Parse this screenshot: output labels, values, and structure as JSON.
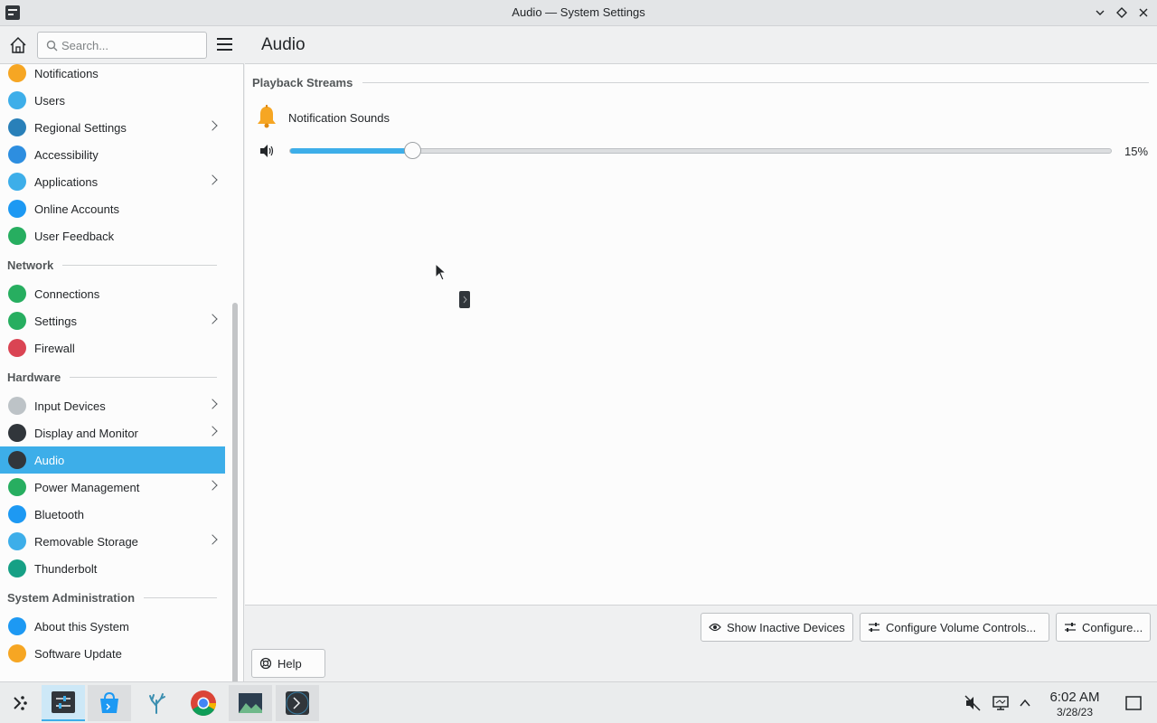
{
  "window": {
    "title": "Audio — System Settings"
  },
  "sidebar": {
    "search_placeholder": "Search...",
    "items_top": [
      {
        "label": "Notifications",
        "icon": "bell-icon",
        "color": "#f6a623",
        "chevron": false
      },
      {
        "label": "Users",
        "icon": "users-icon",
        "color": "#3daee9",
        "chevron": false
      },
      {
        "label": "Regional Settings",
        "icon": "regional-icon",
        "color": "#2980b9",
        "chevron": true
      },
      {
        "label": "Accessibility",
        "icon": "accessibility-icon",
        "color": "#2d8ee0",
        "chevron": false
      },
      {
        "label": "Applications",
        "icon": "applications-icon",
        "color": "#3daee9",
        "chevron": true
      },
      {
        "label": "Online Accounts",
        "icon": "online-accounts-icon",
        "color": "#1d99f3",
        "chevron": false
      },
      {
        "label": "User Feedback",
        "icon": "feedback-icon",
        "color": "#27ae60",
        "chevron": false
      }
    ],
    "network_header": "Network",
    "network_items": [
      {
        "label": "Connections",
        "icon": "globe-icon",
        "color": "#27ae60",
        "chevron": false
      },
      {
        "label": "Settings",
        "icon": "globe-settings-icon",
        "color": "#27ae60",
        "chevron": true
      },
      {
        "label": "Firewall",
        "icon": "firewall-icon",
        "color": "#da4453",
        "chevron": false
      }
    ],
    "hardware_header": "Hardware",
    "hardware_items": [
      {
        "label": "Input Devices",
        "icon": "mouse-icon",
        "color": "#bdc3c7",
        "chevron": true
      },
      {
        "label": "Display and Monitor",
        "icon": "monitor-icon",
        "color": "#31363b",
        "chevron": true
      },
      {
        "label": "Audio",
        "icon": "speaker-icon",
        "color": "#31363b",
        "chevron": false,
        "active": true
      },
      {
        "label": "Power Management",
        "icon": "power-icon",
        "color": "#27ae60",
        "chevron": true
      },
      {
        "label": "Bluetooth",
        "icon": "bluetooth-icon",
        "color": "#1d99f3",
        "chevron": false
      },
      {
        "label": "Removable Storage",
        "icon": "usb-icon",
        "color": "#3daee9",
        "chevron": true
      },
      {
        "label": "Thunderbolt",
        "icon": "thunderbolt-icon",
        "color": "#16a085",
        "chevron": false
      }
    ],
    "sysadmin_header": "System Administration",
    "sysadmin_items": [
      {
        "label": "About this System",
        "icon": "info-icon",
        "color": "#1d99f3",
        "chevron": false
      },
      {
        "label": "Software Update",
        "icon": "software-update-icon",
        "color": "#f6a623",
        "chevron": false
      }
    ]
  },
  "main": {
    "page_title": "Audio",
    "playback_header": "Playback Streams",
    "stream": {
      "name": "Notification Sounds",
      "volume_percent": 15,
      "volume_label": "15%"
    },
    "buttons": {
      "show_inactive": "Show Inactive Devices",
      "configure_volume": "Configure Volume Controls...",
      "configure": "Configure...",
      "help": "Help"
    }
  },
  "taskbar": {
    "apps": [
      {
        "name": "system-settings-icon",
        "state": "active"
      },
      {
        "name": "discover-store-icon",
        "state": "open"
      },
      {
        "name": "app-coral-icon",
        "state": "normal"
      },
      {
        "name": "chrome-icon",
        "state": "normal"
      },
      {
        "name": "image-viewer-icon",
        "state": "open"
      },
      {
        "name": "terminal-icon",
        "state": "open"
      }
    ],
    "time": "6:02 AM",
    "date": "3/28/23"
  },
  "colors": {
    "accent": "#3daee9",
    "background": "#eff0f1",
    "surface": "#fcfcfc",
    "text": "#232629"
  }
}
